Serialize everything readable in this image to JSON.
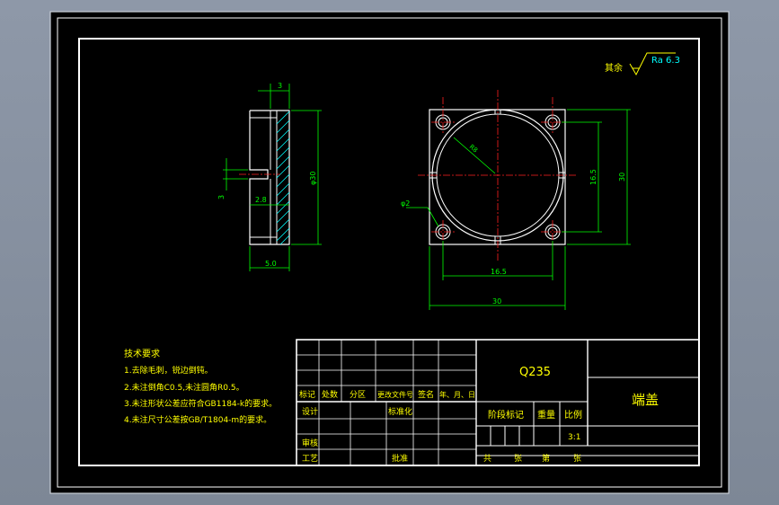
{
  "colors": {
    "background": "#000000",
    "frame": "#ffffff",
    "geometry": "#ffffff",
    "dimension": "#00ff00",
    "hatch": "#00ffff",
    "centerline": "#ff2020",
    "note_text": "#ffff00",
    "title_text": "#ffff00",
    "material_text": "#ffff00"
  },
  "roughness": {
    "prefix": "其余",
    "value": "Ra 6.3"
  },
  "side_view": {
    "dims": {
      "top": "3",
      "height": "φ30",
      "slot_depth": "2.8",
      "slot_width": "3",
      "bottom": "5.0"
    }
  },
  "front_view": {
    "dims": {
      "radius": "R8",
      "hole": "φ2",
      "pitch_v": "16.5",
      "height": "30",
      "pitch_h": "16.5",
      "width": "30"
    }
  },
  "notes": {
    "title": "技术要求",
    "items": [
      "1.去除毛刺，锐边倒钝。",
      "2.未注倒角C0.5,未注圆角R0.5。",
      "3.未注形状公差应符合GB1184-k的要求。",
      "4.未注尺寸公差按GB/T1804-m的要求。"
    ]
  },
  "title_block": {
    "material": "Q235",
    "part_name": "端盖",
    "rev_headers": [
      "标记",
      "处数",
      "分区",
      "更改文件号",
      "签名",
      "年、月、日"
    ],
    "design": "设计",
    "standardize": "标准化",
    "review": "审核",
    "process": "工艺",
    "approve": "批准",
    "stage_mark": "阶段标记",
    "weight": "重量",
    "scale_label": "比例",
    "scale_value": "3:1",
    "sheets": [
      "共",
      "张",
      "第",
      "张"
    ]
  }
}
